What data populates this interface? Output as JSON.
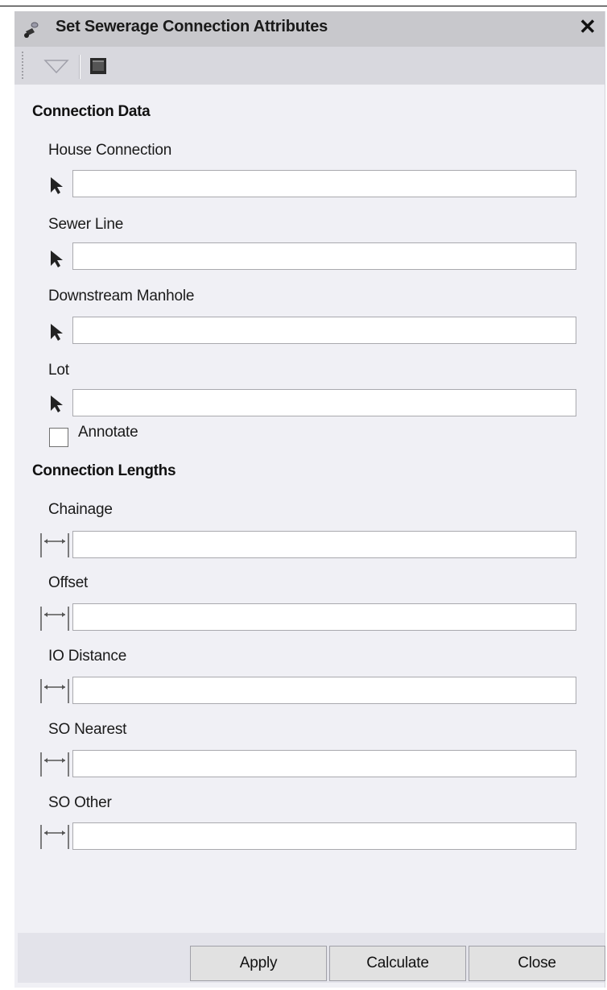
{
  "window": {
    "title": "Set Sewerage Connection Attributes",
    "close_glyph": "✕",
    "icon": "tool-icon"
  },
  "toolbar": {
    "dropdown_icon": "chevron-down-icon",
    "console_icon": "console-icon"
  },
  "connection_data": {
    "title": "Connection Data",
    "fields": [
      {
        "label": "House Connection",
        "value": "",
        "icon": "pick-arrow-icon"
      },
      {
        "label": "Sewer Line",
        "value": "",
        "icon": "pick-arrow-icon"
      },
      {
        "label": "Downstream Manhole",
        "value": "",
        "icon": "pick-arrow-icon"
      },
      {
        "label": "Lot",
        "value": "",
        "icon": "pick-arrow-icon"
      }
    ],
    "annotate": {
      "label": "Annotate",
      "checked": false
    }
  },
  "connection_lengths": {
    "title": "Connection Lengths",
    "fields": [
      {
        "label": "Chainage",
        "value": "",
        "icon": "measure-distance-icon"
      },
      {
        "label": "Offset",
        "value": "",
        "icon": "measure-distance-icon"
      },
      {
        "label": "IO Distance",
        "value": "",
        "icon": "measure-distance-icon"
      },
      {
        "label": "SO Nearest",
        "value": "",
        "icon": "measure-distance-icon"
      },
      {
        "label": "SO Other",
        "value": "",
        "icon": "measure-distance-icon"
      }
    ]
  },
  "buttons": {
    "apply": "Apply",
    "calculate": "Calculate",
    "close": "Close"
  }
}
